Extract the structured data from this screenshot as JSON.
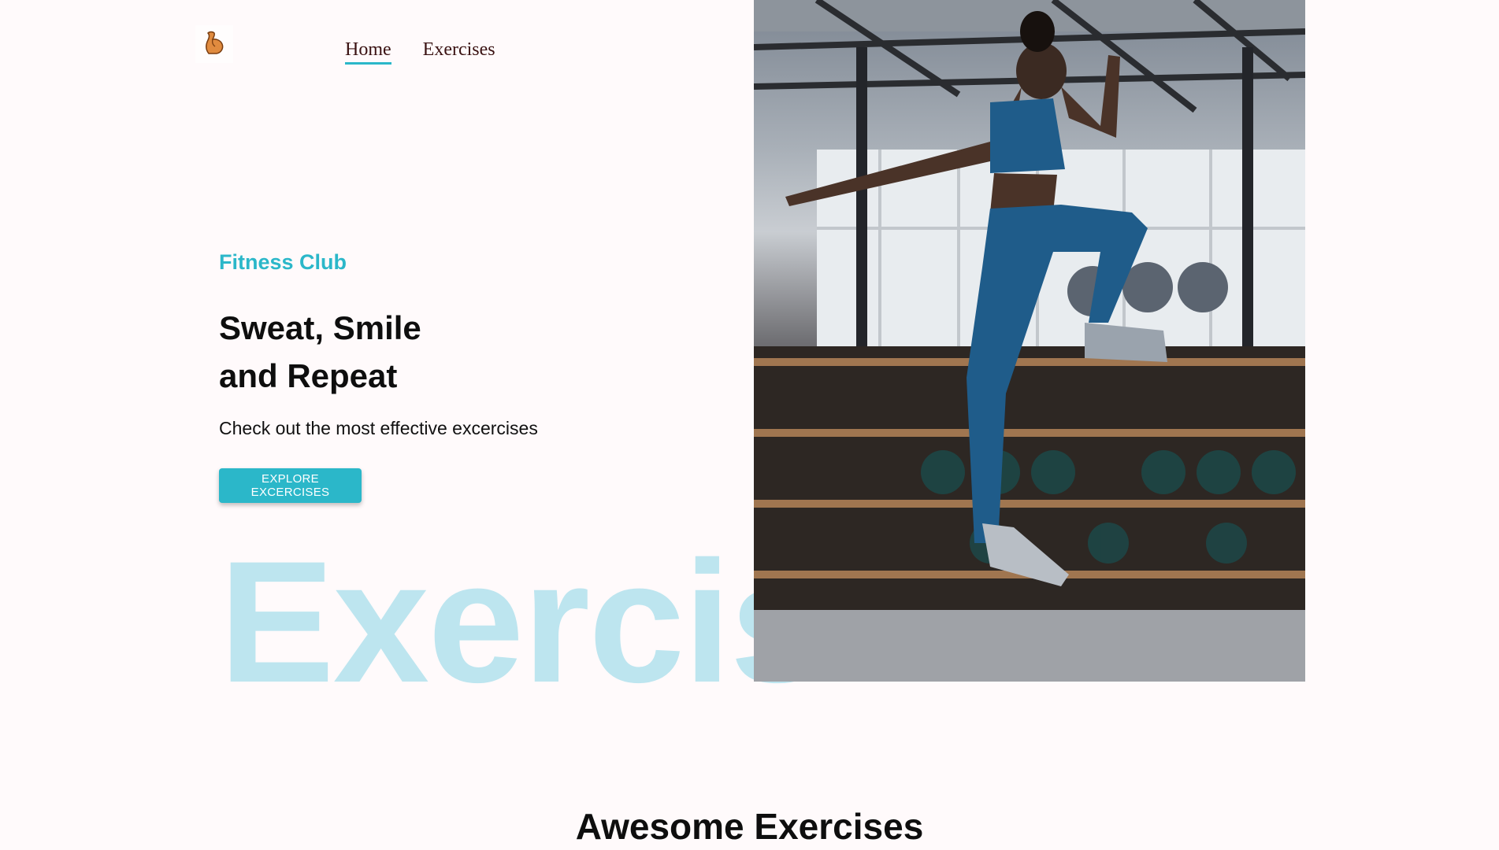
{
  "nav": {
    "logo_icon": "flexed-biceps-icon",
    "logo_glyph": "💪",
    "items": [
      {
        "label": "Home",
        "active": true
      },
      {
        "label": "Exercises",
        "active": false
      }
    ]
  },
  "hero": {
    "eyebrow": "Fitness Club",
    "headline_line1": "Sweat, Smile",
    "headline_line2": "and Repeat",
    "subtext": "Check out the most effective excercises",
    "cta_label": "EXPLORE EXCERCISES",
    "watermark": "Exercis",
    "image_alt": "woman-jumping-in-gym-photo"
  },
  "sections": {
    "exercises_title": "Awesome Exercises"
  },
  "colors": {
    "accent": "#2bb7c9",
    "background": "#fffafb",
    "watermark": "#bde5ef",
    "text": "#0e0e0e"
  }
}
